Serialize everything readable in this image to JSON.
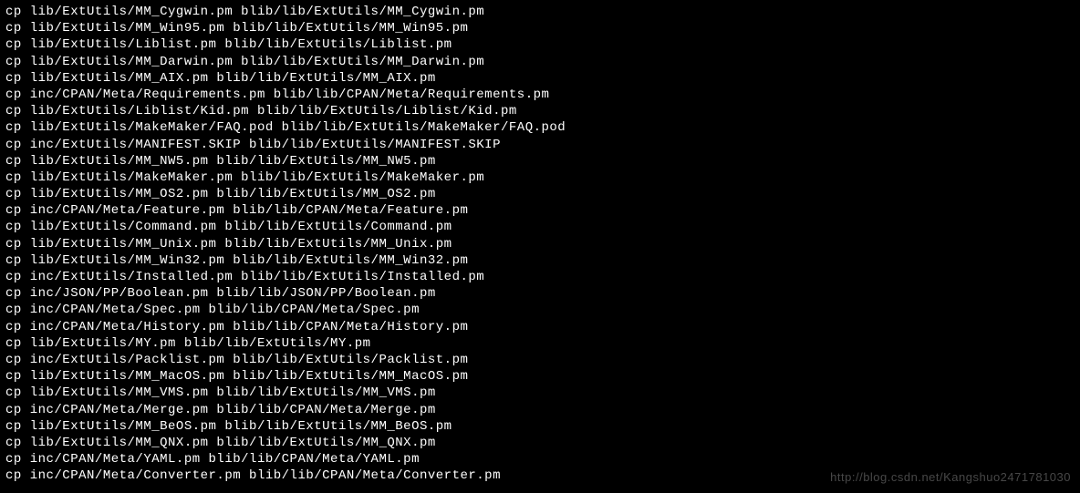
{
  "terminal": {
    "lines": [
      "cp lib/ExtUtils/MM_Cygwin.pm blib/lib/ExtUtils/MM_Cygwin.pm",
      "cp lib/ExtUtils/MM_Win95.pm blib/lib/ExtUtils/MM_Win95.pm",
      "cp lib/ExtUtils/Liblist.pm blib/lib/ExtUtils/Liblist.pm",
      "cp lib/ExtUtils/MM_Darwin.pm blib/lib/ExtUtils/MM_Darwin.pm",
      "cp lib/ExtUtils/MM_AIX.pm blib/lib/ExtUtils/MM_AIX.pm",
      "cp inc/CPAN/Meta/Requirements.pm blib/lib/CPAN/Meta/Requirements.pm",
      "cp lib/ExtUtils/Liblist/Kid.pm blib/lib/ExtUtils/Liblist/Kid.pm",
      "cp lib/ExtUtils/MakeMaker/FAQ.pod blib/lib/ExtUtils/MakeMaker/FAQ.pod",
      "cp inc/ExtUtils/MANIFEST.SKIP blib/lib/ExtUtils/MANIFEST.SKIP",
      "cp lib/ExtUtils/MM_NW5.pm blib/lib/ExtUtils/MM_NW5.pm",
      "cp lib/ExtUtils/MakeMaker.pm blib/lib/ExtUtils/MakeMaker.pm",
      "cp lib/ExtUtils/MM_OS2.pm blib/lib/ExtUtils/MM_OS2.pm",
      "cp inc/CPAN/Meta/Feature.pm blib/lib/CPAN/Meta/Feature.pm",
      "cp lib/ExtUtils/Command.pm blib/lib/ExtUtils/Command.pm",
      "cp lib/ExtUtils/MM_Unix.pm blib/lib/ExtUtils/MM_Unix.pm",
      "cp lib/ExtUtils/MM_Win32.pm blib/lib/ExtUtils/MM_Win32.pm",
      "cp inc/ExtUtils/Installed.pm blib/lib/ExtUtils/Installed.pm",
      "cp inc/JSON/PP/Boolean.pm blib/lib/JSON/PP/Boolean.pm",
      "cp inc/CPAN/Meta/Spec.pm blib/lib/CPAN/Meta/Spec.pm",
      "cp inc/CPAN/Meta/History.pm blib/lib/CPAN/Meta/History.pm",
      "cp lib/ExtUtils/MY.pm blib/lib/ExtUtils/MY.pm",
      "cp inc/ExtUtils/Packlist.pm blib/lib/ExtUtils/Packlist.pm",
      "cp lib/ExtUtils/MM_MacOS.pm blib/lib/ExtUtils/MM_MacOS.pm",
      "cp lib/ExtUtils/MM_VMS.pm blib/lib/ExtUtils/MM_VMS.pm",
      "cp inc/CPAN/Meta/Merge.pm blib/lib/CPAN/Meta/Merge.pm",
      "cp lib/ExtUtils/MM_BeOS.pm blib/lib/ExtUtils/MM_BeOS.pm",
      "cp lib/ExtUtils/MM_QNX.pm blib/lib/ExtUtils/MM_QNX.pm",
      "cp inc/CPAN/Meta/YAML.pm blib/lib/CPAN/Meta/YAML.pm",
      "cp inc/CPAN/Meta/Converter.pm blib/lib/CPAN/Meta/Converter.pm"
    ]
  },
  "watermark": {
    "text": "http://blog.csdn.net/Kangshuo2471781030"
  }
}
